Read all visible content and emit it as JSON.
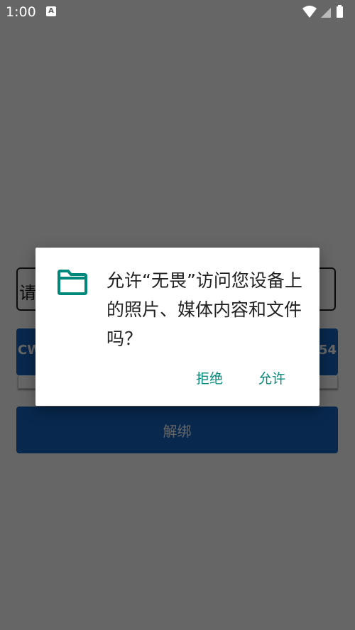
{
  "status_bar": {
    "time": "1:00",
    "notification_glyph": "A"
  },
  "app": {
    "input_prefix": "请",
    "bind_row_left": "CW",
    "bind_row_right": "54",
    "unbind_button": "解绑"
  },
  "dialog": {
    "message": "允许“无畏”访问您设备上的照片、媒体内容和文件吗？",
    "deny_label": "拒绝",
    "allow_label": "允许",
    "icon": "folder-icon"
  },
  "colors": {
    "accent": "#00897b",
    "app_button": "#1565c0",
    "scrim": "rgba(0,0,0,0.6)"
  }
}
